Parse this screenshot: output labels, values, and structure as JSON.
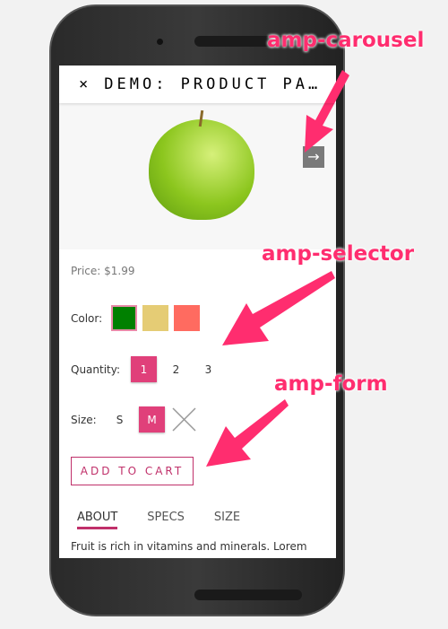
{
  "header": {
    "close_icon": "×",
    "title": "DEMO: PRODUCT PA…"
  },
  "carousel": {
    "next_icon": "→"
  },
  "product": {
    "price": "Price: $1.99",
    "color_label": "Color:",
    "colors": [
      "#008000",
      "#e5cc75",
      "#ff6b60"
    ],
    "selected_color": 0,
    "quantity_label": "Quantity:",
    "quantities": [
      "1",
      "2",
      "3"
    ],
    "size_label": "Size:",
    "sizes": [
      "S",
      "M"
    ],
    "add_to_cart": "ADD TO CART",
    "tabs": [
      "ABOUT",
      "SPECS",
      "SIZE"
    ],
    "description": "Fruit is rich in vitamins and minerals. Lorem"
  },
  "callouts": {
    "carousel": "amp-carousel",
    "selector": "amp-selector",
    "form": "amp-form"
  },
  "colors": {
    "accent": "#e0407a",
    "callout": "#ff2d6f"
  }
}
